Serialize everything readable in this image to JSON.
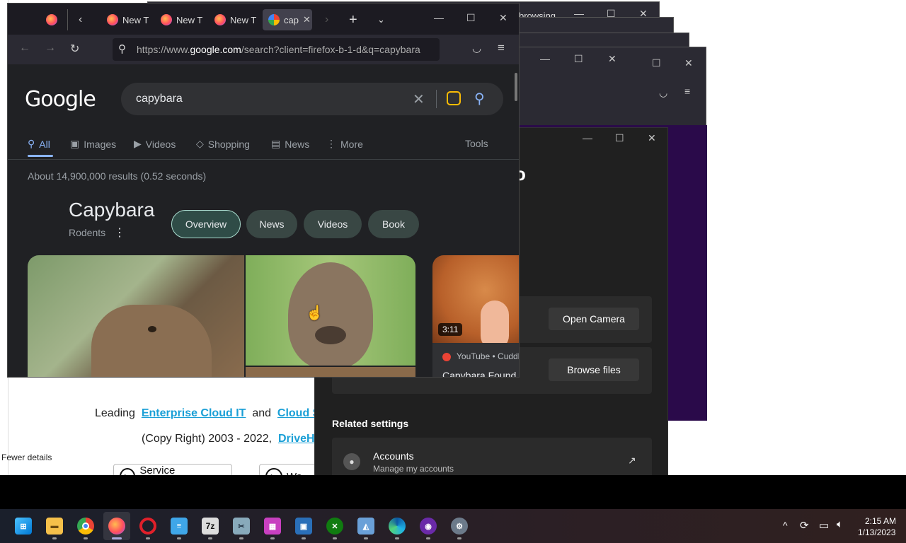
{
  "background": {
    "left_labels": {
      "fewer_details": "Fewer details"
    },
    "web_page": {
      "line1_prefix": "Leading",
      "line1_link1": "Enterprise Cloud IT",
      "line1_mid": "and",
      "line1_link2": "Cloud Sur",
      "line2_prefix": "(Copy Right) 2003 - 2022,",
      "line2_link": "DriveHQ",
      "btn_service": "Service Introduction",
      "btn_wa": "Wa"
    },
    "window_top": {
      "title_fragment": "browsing"
    },
    "settings": {
      "title_fragment": "o",
      "open_camera": "Open Camera",
      "browse_files": "Browse files",
      "related_settings": "Related settings",
      "accounts_title": "Accounts",
      "accounts_subtitle": "Manage my accounts"
    }
  },
  "firefox": {
    "tabs": [
      {
        "label": "New T"
      },
      {
        "label": "New T"
      },
      {
        "label": "New T"
      },
      {
        "label": "cap"
      }
    ],
    "url_prefix": "https://www.",
    "url_domain": "google.com",
    "url_rest": "/search?client=firefox-b-1-d&q=capybara"
  },
  "google": {
    "logo": "Google",
    "query": "capybara",
    "tabs": [
      "All",
      "Images",
      "Videos",
      "Shopping",
      "News",
      "More"
    ],
    "tools": "Tools",
    "result_stats": "About 14,900,000 results (0.52 seconds)",
    "kp_title": "Capybara",
    "kp_subtitle": "Rodents",
    "chips": [
      "Overview",
      "News",
      "Videos",
      "Book"
    ],
    "video": {
      "duration": "3:11",
      "source": "YouTube • Cuddl",
      "title": "Capybara Found"
    }
  },
  "taskbar": {
    "apps": [
      "start",
      "file-explorer",
      "chrome",
      "firefox",
      "opera",
      "notepad",
      "7zip",
      "screenshot",
      "app-purple",
      "remote",
      "xbox",
      "photos",
      "edge",
      "game",
      "settings"
    ],
    "time": "2:15 AM",
    "date": "1/13/2023"
  },
  "colors": {
    "accent_blue": "#8ab4f8",
    "chip_bg": "#394744",
    "link_blue": "#1a9fd6"
  }
}
